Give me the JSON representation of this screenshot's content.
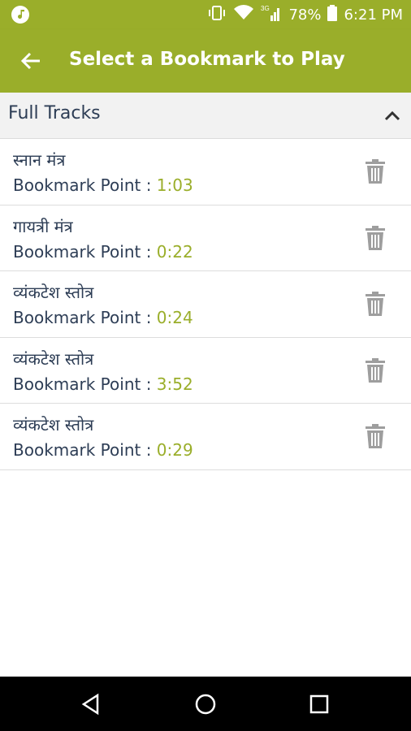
{
  "status_bar": {
    "app_icon": "music-note-icon",
    "battery": "78%",
    "time": "6:21 PM",
    "network": "3G"
  },
  "app_bar": {
    "title": "Select a Bookmark to Play",
    "back_icon": "arrow-left-icon"
  },
  "section": {
    "label": "Full Tracks",
    "toggle_icon": "chevron-up-icon"
  },
  "bookmarks": [
    {
      "name": "स्नान मंत्र",
      "point_label": "Bookmark Point : ",
      "time": "1:03"
    },
    {
      "name": "गायत्री मंत्र",
      "point_label": "Bookmark Point : ",
      "time": "0:22"
    },
    {
      "name": "व्यंकटेश स्तोत्र",
      "point_label": "Bookmark Point : ",
      "time": "0:24"
    },
    {
      "name": "व्यंकटेश स्तोत्र",
      "point_label": "Bookmark Point : ",
      "time": "3:52"
    },
    {
      "name": "व्यंकटेश स्तोत्र",
      "point_label": "Bookmark Point : ",
      "time": "0:29"
    }
  ],
  "colors": {
    "accent": "#9aae2a",
    "text": "#2d3d55",
    "icon_gray": "#9e9e9e"
  }
}
